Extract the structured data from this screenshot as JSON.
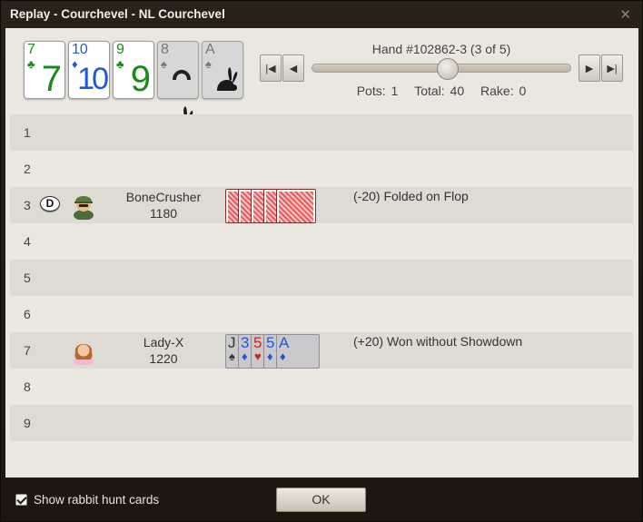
{
  "window": {
    "title": "Replay - Courchevel - NL Courchevel",
    "close_glyph": "✕"
  },
  "board_cards": [
    {
      "rank": "7",
      "suit": "♣",
      "suit_name": "clubs",
      "face": "7",
      "rabbit": false
    },
    {
      "rank": "10",
      "suit": "♦",
      "suit_name": "diamonds",
      "face": "10",
      "rabbit": false
    },
    {
      "rank": "9",
      "suit": "♣",
      "suit_name": "clubs",
      "face": "9",
      "rabbit": false
    },
    {
      "rank": "8",
      "suit": "♠",
      "suit_name": "spades",
      "face": "rabbit-icon",
      "rabbit": true
    },
    {
      "rank": "A",
      "suit": "♠",
      "suit_name": "spades",
      "face": "rabbit-icon",
      "rabbit": true
    }
  ],
  "replay": {
    "hand_label": "Hand #102862-3 (3 of 5)",
    "slider_fraction": 0.5,
    "pots": "Pots: 1",
    "total": "Total: 40",
    "rake": "Rake: 0",
    "buttons": {
      "first": "|◀",
      "prev": "◀",
      "next": "▶",
      "last": "▶|"
    }
  },
  "seats": [
    {
      "num": "1"
    },
    {
      "num": "2"
    },
    {
      "num": "3",
      "dealer": "D",
      "name": "BoneCrusher",
      "chips": "1180",
      "result": "(-20) Folded on Flop",
      "avatar": "soldier-avatar"
    },
    {
      "num": "4"
    },
    {
      "num": "5"
    },
    {
      "num": "6"
    },
    {
      "num": "7",
      "name": "Lady-X",
      "chips": "1220",
      "result": "(+20) Won without Showdown",
      "avatar": "lady-avatar",
      "cards": [
        {
          "rank": "J",
          "suit": "♠",
          "suit_name": "spades"
        },
        {
          "rank": "3",
          "suit": "♦",
          "suit_name": "diamonds"
        },
        {
          "rank": "5",
          "suit": "♥",
          "suit_name": "hearts"
        },
        {
          "rank": "5",
          "suit": "♦",
          "suit_name": "diamonds"
        },
        {
          "rank": "A",
          "suit": "♦",
          "suit_name": "diamonds"
        }
      ]
    },
    {
      "num": "8"
    },
    {
      "num": "9"
    }
  ],
  "footer": {
    "rabbit_checkbox_label": "Show rabbit hunt cards",
    "rabbit_checkbox_checked": true,
    "ok_label": "OK"
  },
  "colors": {
    "clubs": "#1b8a1b",
    "diamonds": "#1e58d6",
    "hearts": "#c62828",
    "spades": "#333333"
  }
}
